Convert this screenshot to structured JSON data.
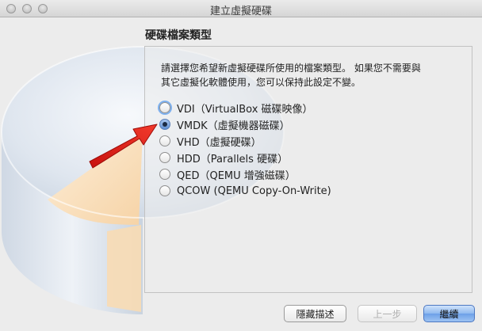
{
  "window": {
    "title": "建立虛擬硬碟"
  },
  "section": {
    "title": "硬碟檔案類型"
  },
  "description": {
    "line1": "請選擇您希望新虛擬硬碟所使用的檔案類型。 如果您不需要與",
    "line2": "其它虛擬化軟體使用，您可以保持此設定不變。"
  },
  "options": [
    {
      "label": "VDI（VirtualBox 磁碟映像）",
      "selected": false
    },
    {
      "label": "VMDK（虛擬機器磁碟）",
      "selected": true
    },
    {
      "label": "VHD（虛擬硬碟）",
      "selected": false
    },
    {
      "label": "HDD（Parallels 硬碟）",
      "selected": false
    },
    {
      "label": "QED（QEMU 增強磁碟）",
      "selected": false
    },
    {
      "label": "QCOW (QEMU Copy-On-Write)",
      "selected": false
    }
  ],
  "buttons": {
    "hide_description": "隱藏描述",
    "back": "上一步",
    "continue": "繼續"
  },
  "colors": {
    "annotation_arrow": "#e0201b",
    "default_button": "#6ca0e8"
  }
}
